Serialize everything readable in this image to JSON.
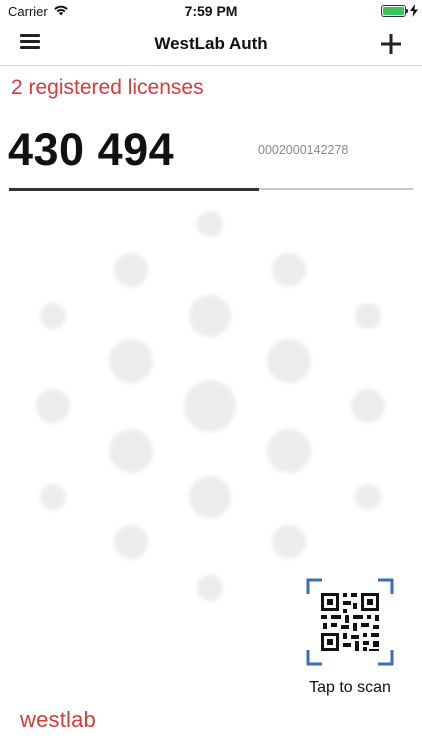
{
  "status_bar": {
    "carrier": "Carrier",
    "time": "7:59 PM",
    "battery_level": 1.0
  },
  "nav": {
    "title": "WestLab Auth",
    "menu_icon": "hamburger-menu-icon",
    "add_icon": "plus-icon"
  },
  "licenses_text": "2 registered licenses",
  "otp": {
    "code": "430 494",
    "serial": "0002000142278",
    "progress": 0.62
  },
  "scan": {
    "label": "Tap to scan",
    "icon": "qr-code-scan-icon"
  },
  "brand": {
    "name": "westlab"
  },
  "colors": {
    "accent_red": "#d93a3a",
    "scan_frame_blue": "#3b6db3",
    "battery_green": "#34c759",
    "dots_gray": "#ececec"
  }
}
